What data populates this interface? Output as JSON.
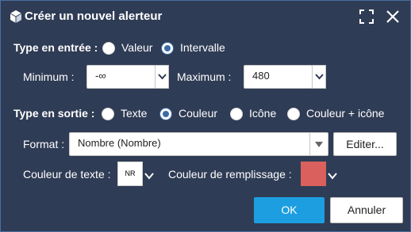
{
  "title": "Créer un nouvel alerteur",
  "input_type": {
    "label": "Type en entrée :",
    "options": [
      "Valeur",
      "Intervalle"
    ],
    "selected": "Intervalle"
  },
  "minimum": {
    "label": "Minimum :",
    "value": "-∞"
  },
  "maximum": {
    "label": "Maximum :",
    "value": "480"
  },
  "output_type": {
    "label": "Type en sortie :",
    "options": [
      "Texte",
      "Couleur",
      "Icône",
      "Couleur + icône"
    ],
    "selected": "Couleur"
  },
  "format": {
    "label": "Format :",
    "value": "Nombre (Nombre)",
    "edit_label": "Editer..."
  },
  "text_color": {
    "label": "Couleur de texte :",
    "swatch_text": "NR",
    "color": "#ffffff"
  },
  "fill_color": {
    "label": "Couleur de remplissage :",
    "color": "#d9605c"
  },
  "buttons": {
    "ok": "OK",
    "cancel": "Annuler"
  },
  "colors": {
    "background": "#2f3c55",
    "accent": "#1c9ee0",
    "selected_radio": "#3a6aa8"
  },
  "icons": {
    "title": "cube-icon",
    "expand": "expand-icon",
    "close": "close-icon",
    "dropdown": "chevron-down-icon"
  }
}
